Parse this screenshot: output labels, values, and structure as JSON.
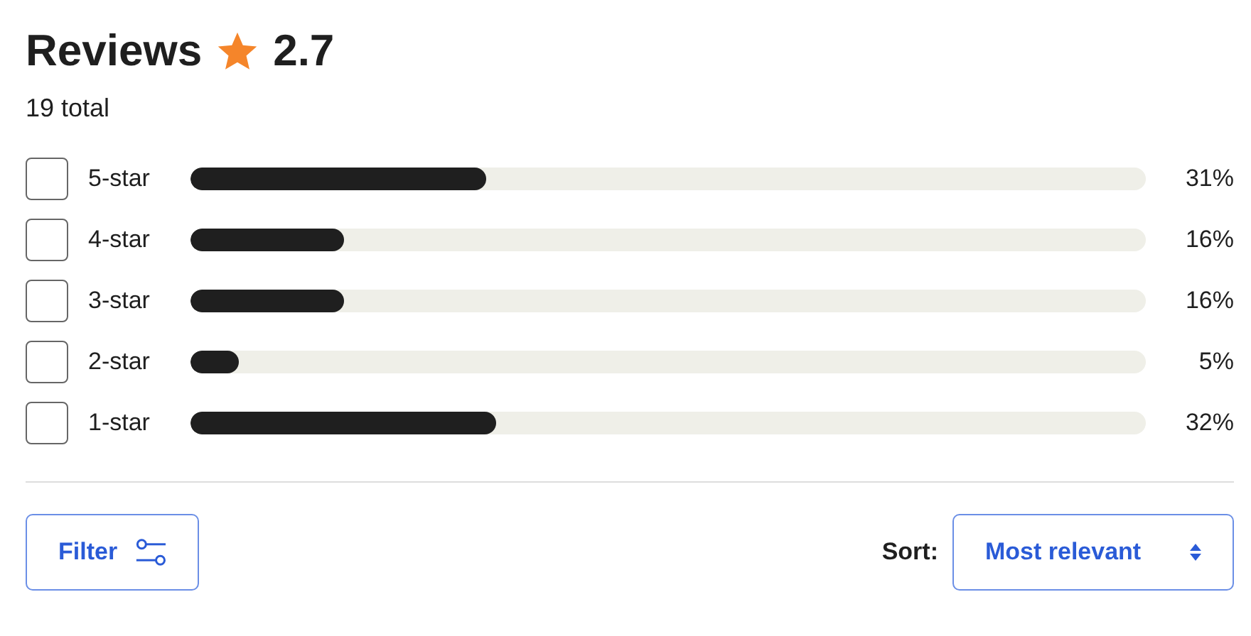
{
  "header": {
    "title": "Reviews",
    "rating": "2.7",
    "total": "19 total"
  },
  "rows": [
    {
      "label": "5-star",
      "checked": false,
      "level": 0.31,
      "percent": "31%"
    },
    {
      "label": "4-star",
      "checked": false,
      "level": 0.16,
      "percent": "16%"
    },
    {
      "label": "3-star",
      "checked": false,
      "level": 0.16,
      "percent": "16%"
    },
    {
      "label": "2-star",
      "checked": false,
      "level": 0.05,
      "percent": "5%"
    },
    {
      "label": "1-star",
      "checked": false,
      "level": 0.32,
      "percent": "32%"
    }
  ],
  "filter_button": {
    "label": "Filter"
  },
  "sort": {
    "label": "Sort:",
    "value": "Most relevant"
  }
}
